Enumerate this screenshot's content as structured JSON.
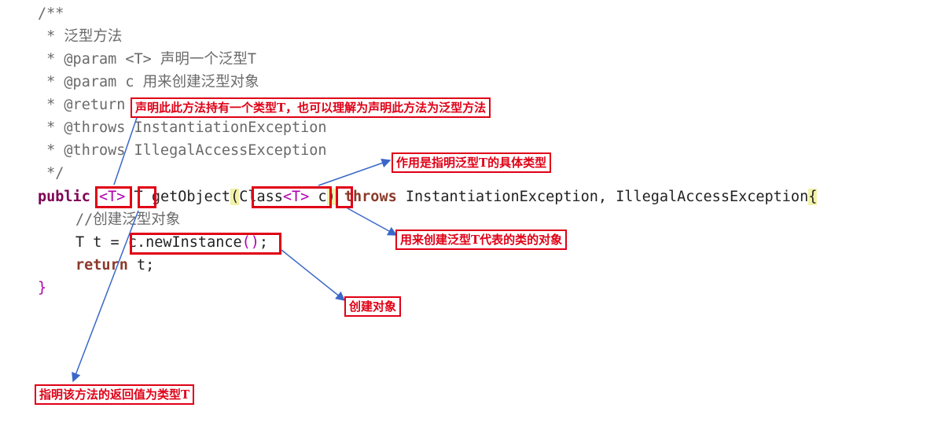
{
  "code": {
    "javadoc_open": "/**",
    "doc_title": " * 泛型方法",
    "doc_param_t": " * @param <T> 声明一个泛型T",
    "doc_param_c": " * @param c 用来创建泛型对象",
    "doc_return": " * @return",
    "doc_throws_1": " * @throws InstantiationException",
    "doc_throws_2": " * @throws IllegalAccessException",
    "javadoc_close": " */",
    "sig_public": "public",
    "sig_type_param": "<T>",
    "sig_return_type": "T",
    "sig_method": "getObject",
    "sig_paren_open": "(",
    "sig_class": "Class",
    "sig_class_generic": "<T>",
    "sig_param": "c",
    "sig_paren_close": ")",
    "sig_throws": "throws",
    "sig_exceptions": "InstantiationException, IllegalAccessException",
    "sig_brace": "{",
    "body_comment": "//创建泛型对象",
    "body_decl": "T t = ",
    "body_call": "c.newInstance",
    "body_call_parens": "()",
    "body_semicolon": ";",
    "body_return_kw": "return",
    "body_return_val": " t;",
    "close_brace": "}"
  },
  "annotations": {
    "type_param_note": "声明此此方法持有一个类型T，也可以理解为声明此方法为泛型方法",
    "class_note": "作用是指明泛型T的具体类型",
    "param_note": "用来创建泛型T代表的类的对象",
    "create_note": "创建对象",
    "return_note": "指明该方法的返回值为类型T"
  },
  "colors": {
    "annotation_red": "#e00016",
    "arrow_blue": "#3a68c8",
    "keyword": "#7f0055",
    "comment": "#6a6a6a",
    "bracket_highlight": "#f2f2a8"
  }
}
